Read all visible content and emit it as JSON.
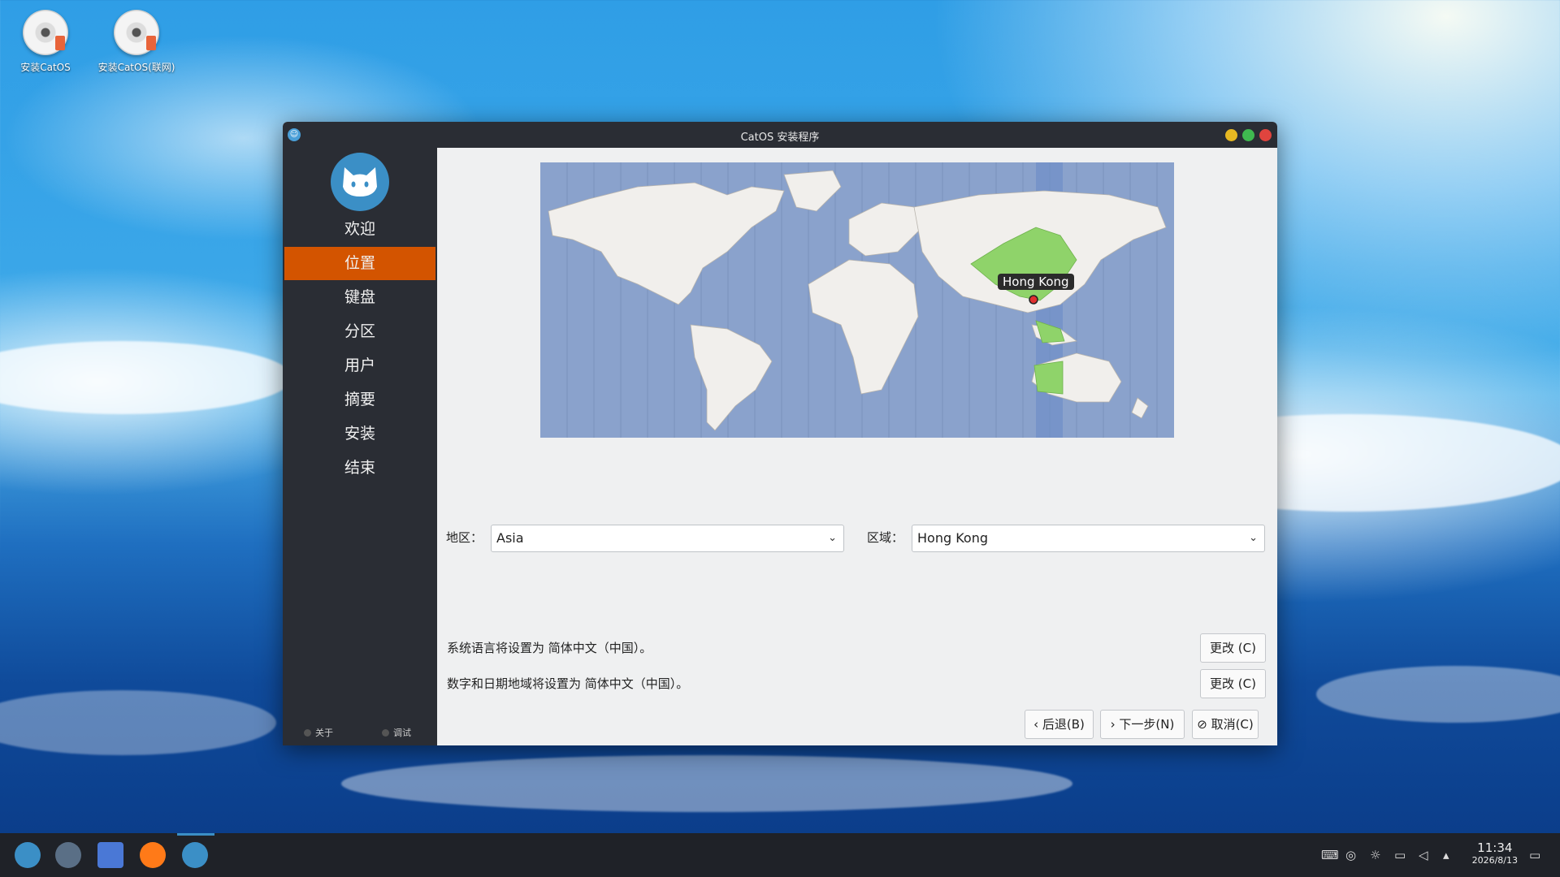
{
  "desktop": {
    "icons": [
      {
        "label": "安装CatOS"
      },
      {
        "label": "安装CatOS(联网)"
      }
    ]
  },
  "window": {
    "title": "CatOS 安装程序",
    "controls": {
      "minimize_color": "#e6b822",
      "maximize_color": "#3fb950",
      "close_color": "#e0443e"
    }
  },
  "sidebar": {
    "items": [
      {
        "label": "欢迎"
      },
      {
        "label": "位置"
      },
      {
        "label": "键盘"
      },
      {
        "label": "分区"
      },
      {
        "label": "用户"
      },
      {
        "label": "摘要"
      },
      {
        "label": "安装"
      },
      {
        "label": "结束"
      }
    ],
    "active_index": 1,
    "accent": "#d35400",
    "footer": {
      "about": "关于",
      "debug": "调试"
    }
  },
  "map": {
    "marker_label": "Hong Kong",
    "highlight_color": "#8fd36a"
  },
  "location": {
    "region_label": "地区：",
    "region_value": "Asia",
    "zone_label": "区域：",
    "zone_value": "Hong Kong"
  },
  "locale": {
    "language_text": "系统语言将设置为 简体中文（中国）。",
    "format_text": "数字和日期地域将设置为 简体中文（中国）。",
    "change_label": "更改 (C)"
  },
  "buttons": {
    "back": "后退(B)",
    "next": "下一步(N)",
    "cancel": "取消(C)"
  },
  "taskbar": {
    "time": "11:34",
    "date": "2026/8/13"
  }
}
